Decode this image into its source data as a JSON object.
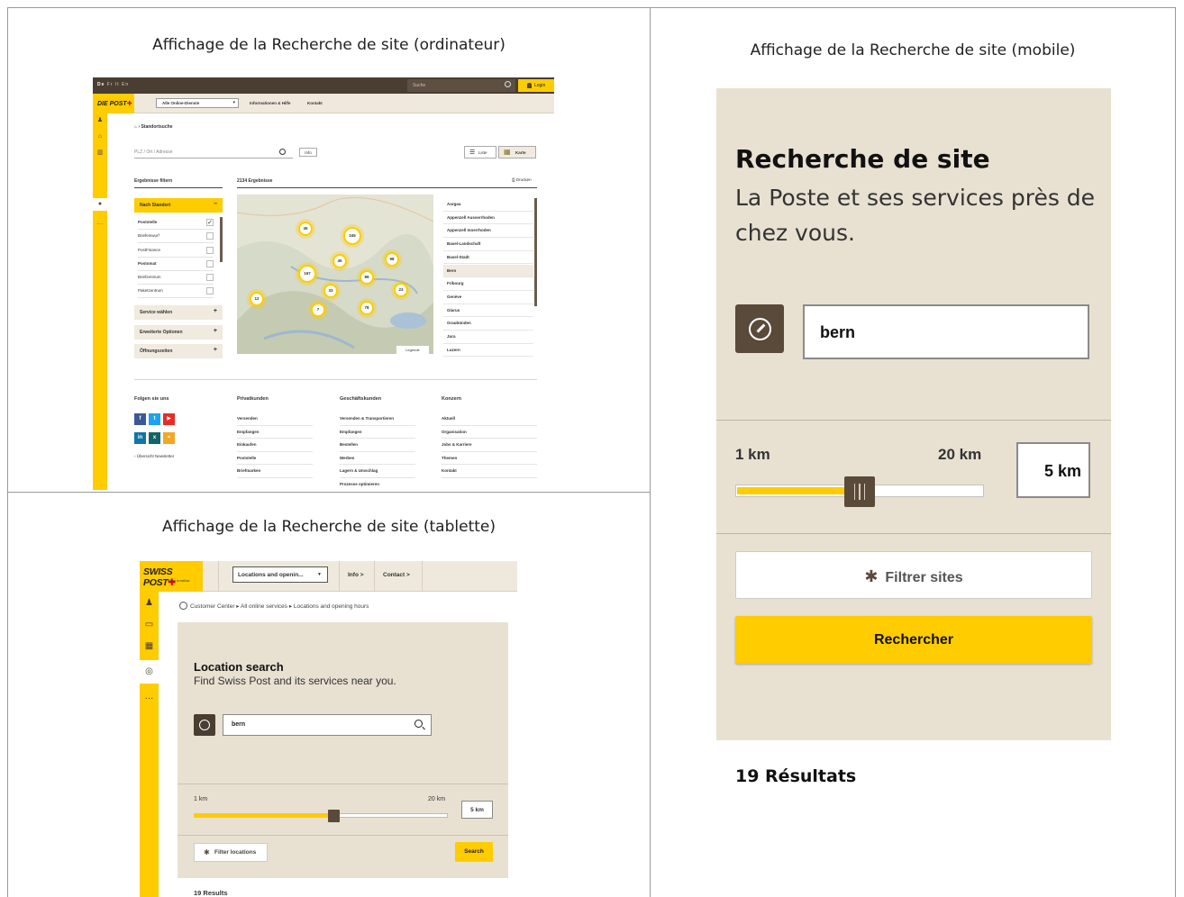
{
  "captions": {
    "desktop": "Affichage de la Recherche de site (ordinateur)",
    "mobile": "Affichage de la Recherche de site (mobile)",
    "tablet": "Affichage de la Recherche de site (tablette)"
  },
  "desktop": {
    "languages": [
      "De",
      "Fr",
      "It",
      "En"
    ],
    "search_placeholder": "Suche",
    "login": "Login",
    "logo": "DIE POST",
    "services_dropdown": "Alle Online-Dienste",
    "nav": [
      "Informationen & Hilfe",
      "Kontakt"
    ],
    "breadcrumb": "› Standortsuche",
    "plz_placeholder": "PLZ / Ort / Adresse",
    "info_button": "Info",
    "view_list": "Liste",
    "view_map": "Karte",
    "filter_title": "Ergebnisse filtern",
    "results_count": "2134 Ergebnisse",
    "print": "Drucken",
    "accordion_standort": "Nach Standort",
    "filter_items": [
      {
        "label": "Poststelle",
        "checked": true
      },
      {
        "label": "Briefeinwurf",
        "checked": false
      },
      {
        "label": "PostFinance",
        "checked": false
      },
      {
        "label": "Postomat",
        "checked": false
      },
      {
        "label": "Briefzentrum",
        "checked": false
      },
      {
        "label": "Paketzentrum",
        "checked": false
      }
    ],
    "accordions": [
      "Service wählen",
      "Erweiterte Optionen",
      "Öffnungszeiten"
    ],
    "map_clusters": [
      "45",
      "345",
      "45",
      "167",
      "98",
      "89",
      "33",
      "23",
      "12",
      "7",
      "78"
    ],
    "legend": "Legende",
    "cantons": [
      "Aargau",
      "Appenzell Ausserrhoden",
      "Appenzell Innerrhoden",
      "Basel-Landschaft",
      "Basel-Stadt",
      "Bern",
      "Fribourg",
      "Genève",
      "Glarus",
      "Graubünden",
      "Jura",
      "Luzern"
    ],
    "footer": {
      "social_title": "Folgen sie uns",
      "newsletter": "› Übersicht Newsletter",
      "columns": [
        {
          "title": "Privatkunden",
          "links": [
            "Versenden",
            "Empfangen",
            "Einkaufen",
            "Poststelle",
            "Briefmarken"
          ]
        },
        {
          "title": "Geschäftskunden",
          "links": [
            "Versenden & Transportieren",
            "Empfangen",
            "Bestellen",
            "Werben",
            "Lagern & Umschlag",
            "Prozesse optimieren"
          ]
        },
        {
          "title": "Konzern",
          "links": [
            "Aktuell",
            "Organisation",
            "Jobs & Karriere",
            "Themen",
            "Kontakt"
          ]
        }
      ]
    }
  },
  "tablet": {
    "logo": "SWISS POST",
    "logo_tagline": "Yellow is mellow",
    "services_dropdown": "Locations and openin...",
    "nav_info": "Info >",
    "nav_contact": "Contact >",
    "breadcrumb": "Customer Center  ▸  All online services  ▸  Locations and opening hours",
    "title": "Location search",
    "subtitle": "Find Swiss Post and its services near you.",
    "input_value": "bern",
    "km_min": "1 km",
    "km_max": "20 km",
    "radius": "5 km",
    "radius_fraction": 0.55,
    "filter_button": "Filter locations",
    "search_button": "Search",
    "results": "19 Results"
  },
  "mobile": {
    "title": "Recherche de site",
    "subtitle": "La Poste et ses services près de chez vous.",
    "input_value": "bern",
    "km_min": "1 km",
    "km_max": "20 km",
    "radius": "5 km",
    "radius_fraction": 0.5,
    "filter_button": "Filtrer sites",
    "search_button": "Rechercher",
    "results": "19 Résultats"
  },
  "colors": {
    "brand_yellow": "#ffcc00",
    "brand_brown": "#4a3d31",
    "panel_beige": "#e8e1d2"
  }
}
